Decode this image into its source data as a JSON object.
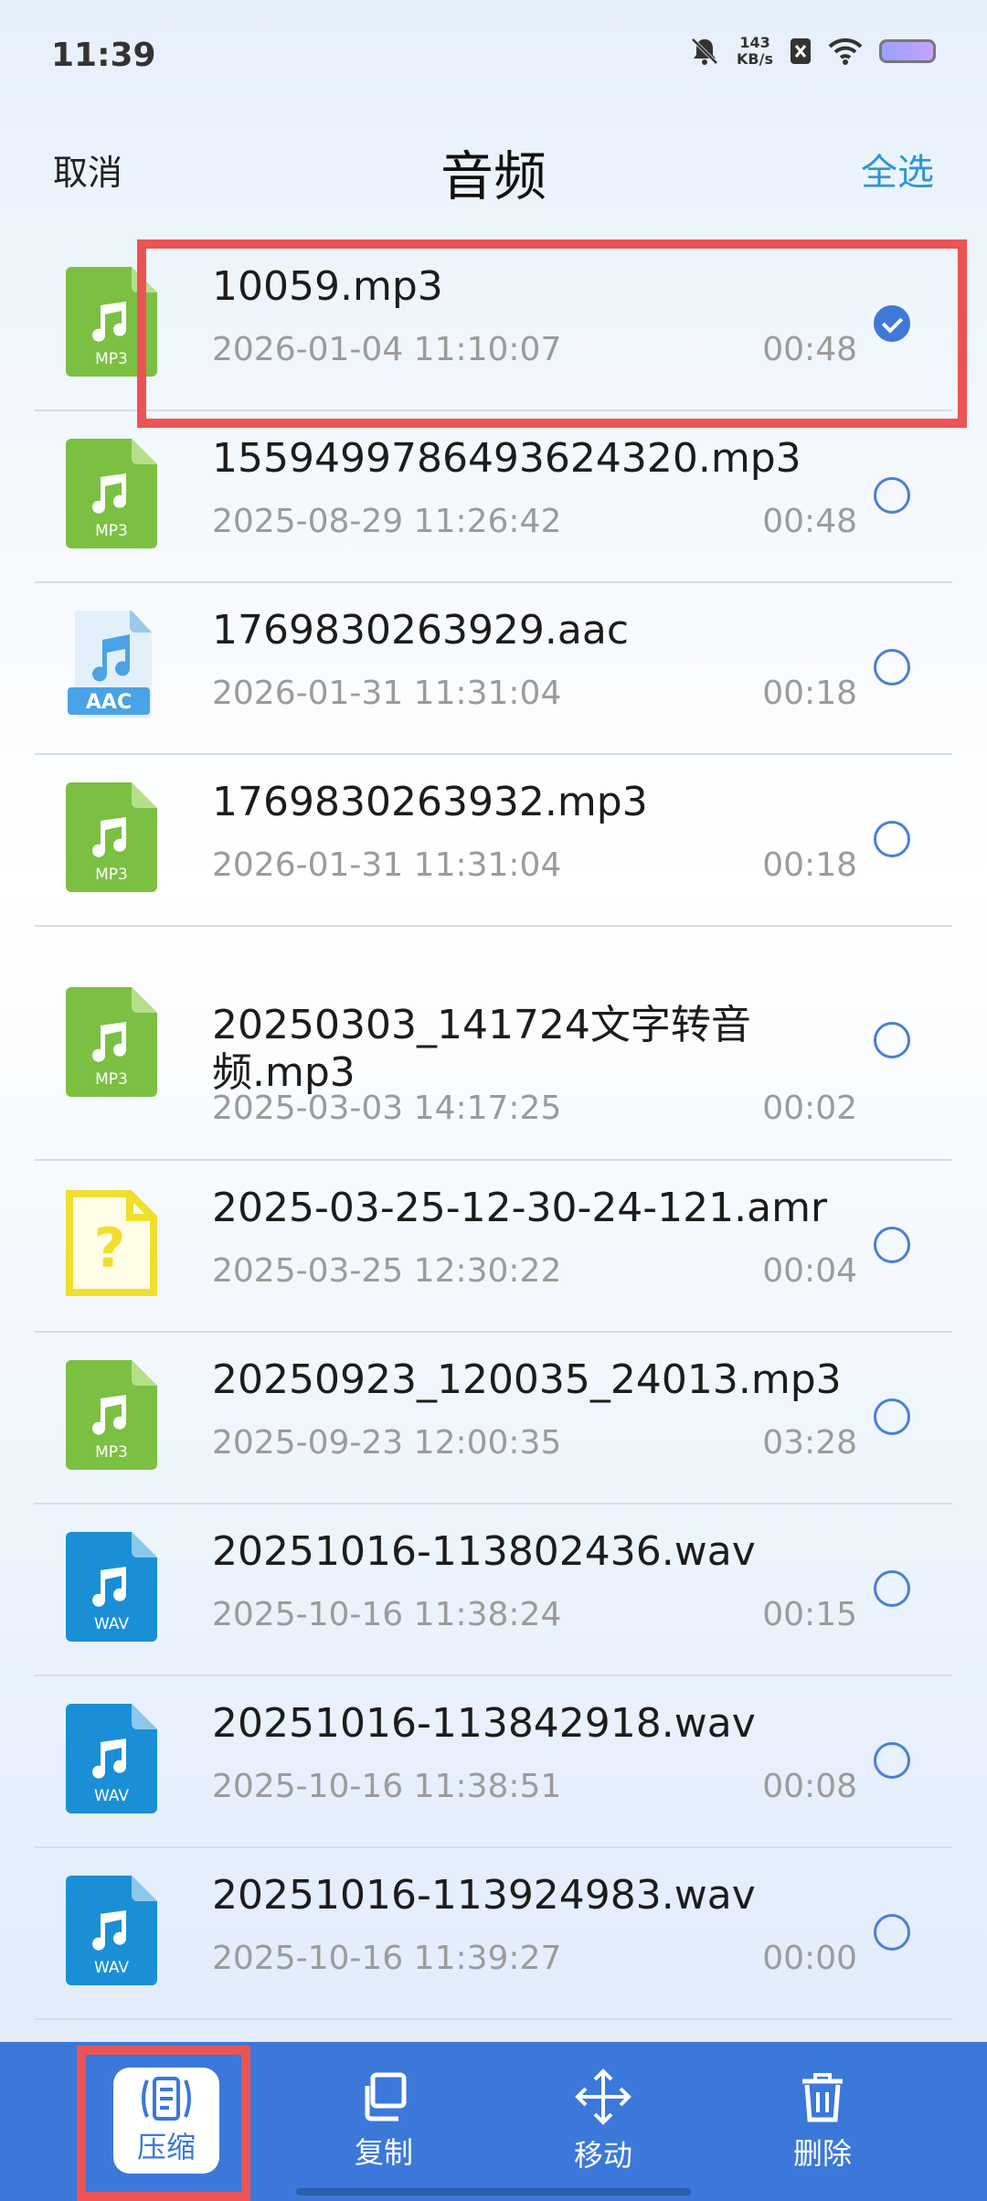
{
  "status": {
    "time": "11:39",
    "net_speed": "143",
    "net_unit": "KB/s"
  },
  "header": {
    "cancel": "取消",
    "title": "音频",
    "select_all": "全选"
  },
  "files": [
    {
      "name": "10059.mp3",
      "date": "2026-01-04 11:10:07",
      "duration": "00:48",
      "type": "MP3",
      "checked": true
    },
    {
      "name": "1559499786493624320.mp3",
      "date": "2025-08-29 11:26:42",
      "duration": "00:48",
      "type": "MP3",
      "checked": false
    },
    {
      "name": "1769830263929.aac",
      "date": "2026-01-31 11:31:04",
      "duration": "00:18",
      "type": "AAC",
      "checked": false
    },
    {
      "name": "1769830263932.mp3",
      "date": "2026-01-31 11:31:04",
      "duration": "00:18",
      "type": "MP3",
      "checked": false
    },
    {
      "name": "20250303_141724文字转音频.mp3",
      "date": "2025-03-03 14:17:25",
      "duration": "00:02",
      "type": "MP3",
      "checked": false
    },
    {
      "name": "2025-03-25-12-30-24-121.amr",
      "date": "2025-03-25 12:30:22",
      "duration": "00:04",
      "type": "unknown",
      "checked": false
    },
    {
      "name": "20250923_120035_24013.mp3",
      "date": "2025-09-23 12:00:35",
      "duration": "03:28",
      "type": "MP3",
      "checked": false
    },
    {
      "name": "20251016-113802436.wav",
      "date": "2025-10-16 11:38:24",
      "duration": "00:15",
      "type": "WAV",
      "checked": false
    },
    {
      "name": "20251016-113842918.wav",
      "date": "2025-10-16 11:38:51",
      "duration": "00:08",
      "type": "WAV",
      "checked": false
    },
    {
      "name": "20251016-113924983.wav",
      "date": "2025-10-16 11:39:27",
      "duration": "00:00",
      "type": "WAV",
      "checked": false
    }
  ],
  "toolbar": {
    "compress": "压缩",
    "copy": "复制",
    "move": "移动",
    "delete": "删除"
  },
  "colors": {
    "accent": "#3b78d9",
    "select_all": "#2c96d6",
    "mp3_icon": "#7cc043",
    "wav_icon": "#1a8fd6",
    "aac_icon": "#4aa3e6",
    "unknown_icon": "#f3e24a",
    "highlight": "#ea5455"
  }
}
